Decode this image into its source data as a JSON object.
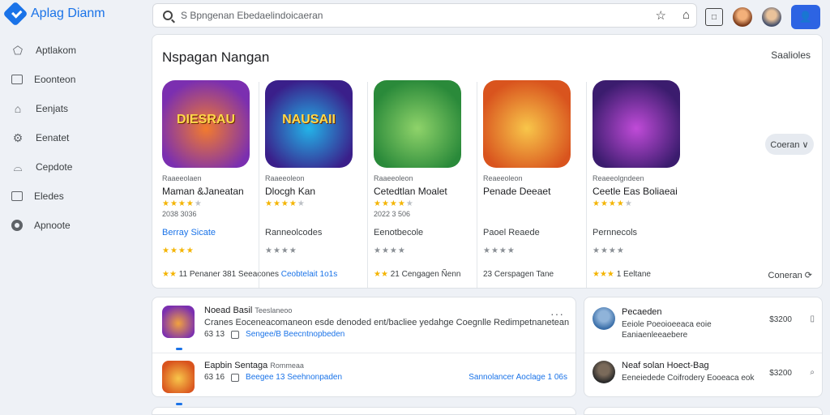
{
  "app": {
    "title": "Aplag Dianm"
  },
  "search": {
    "value": "S Bpngenan Ebedaelindoicaeran"
  },
  "header": {
    "search_actions": [
      "☆",
      "⌂"
    ],
    "box_icon": "□"
  },
  "sidebar": {
    "items": [
      {
        "label": "Aptlakom",
        "icon": "shape-icon"
      },
      {
        "label": "Eoonteon",
        "icon": "screen-icon"
      },
      {
        "label": "Eenjats",
        "icon": "home-icon"
      },
      {
        "label": "Eenatet",
        "icon": "gear-icon"
      },
      {
        "label": "Cepdote",
        "icon": "bag-icon"
      },
      {
        "label": "Eledes",
        "icon": "news-icon"
      },
      {
        "label": "Apnoote",
        "icon": "eye-icon"
      }
    ]
  },
  "section": {
    "title": "Nspagan Nangan",
    "see_all": "Saalioles",
    "next_label": "Coeran ∨",
    "more_link": "Coneran ⟳"
  },
  "apps": [
    {
      "icon_text": "DIESRAU",
      "category": "Raaeeolaen",
      "name": "Maman &Janeatan",
      "rating": 3.5,
      "meta": "2038 3036",
      "sub": "Berray Sicate",
      "sub_blue": true,
      "rating2": 3,
      "rating2_color": "gold",
      "foot_prefix": "★★",
      "foot": "11 Penaner 381 Seeacones",
      "foot_link": "Ceobtelait 1o1s",
      "colors": [
        "#7b2fb0",
        "#f27b2e"
      ]
    },
    {
      "icon_text": "NAUSAII",
      "category": "Raaeeoleon",
      "name": "Dlocgh Kan",
      "rating": 4,
      "meta": "",
      "sub": "Ranneolcodes",
      "sub_blue": false,
      "rating2": 4,
      "rating2_color": "grey",
      "foot_prefix": "",
      "foot": "",
      "foot_link": "",
      "colors": [
        "#3a1f8a",
        "#23b3e8"
      ]
    },
    {
      "icon_text": "",
      "category": "Raaeeoleon",
      "name": "Cetedtlan Moalet",
      "rating": 3.5,
      "meta": "2022 3 506",
      "sub": "Eenotbecole",
      "sub_blue": false,
      "rating2": 3,
      "rating2_color": "grey",
      "foot_prefix": "★★",
      "foot": "21 Cengagen Ñenn",
      "foot_link": "",
      "colors": [
        "#2a8a3a",
        "#8fd36a"
      ]
    },
    {
      "icon_text": "",
      "category": "Reaeeoleon",
      "name": "Penade Deeaet",
      "rating": 0,
      "meta": "",
      "sub": "Paoel Reaede",
      "sub_blue": false,
      "rating2": 4,
      "rating2_color": "grey",
      "foot_prefix": "",
      "foot": "23 Cerspagen Tane",
      "foot_link": "",
      "colors": [
        "#d9541e",
        "#f8c64a"
      ]
    },
    {
      "icon_text": "",
      "category": "Reaeeolgndeen",
      "name": "Ceetle Eas Boliaeai",
      "rating": 4,
      "meta": "",
      "sub": "Pernnecols",
      "sub_blue": false,
      "rating2": 3,
      "rating2_color": "grey",
      "foot_prefix": "★★★",
      "foot": "1 Eeltane",
      "foot_link": "",
      "colors": [
        "#3b1c6e",
        "#c04bd8"
      ]
    }
  ],
  "list": {
    "kebab": "···",
    "rows": [
      {
        "title": "Noead Basil",
        "tag": "Teeslaneoo",
        "desc": "Cranes Eoceneacomaneon esde denoded ent/bacliee yedahge Coegnlle Redimpetnanetean",
        "meta_prefix": "63 13",
        "link": "Sengee/B Beecntnopbeden",
        "right": "",
        "colors": [
          "#7b2fb0",
          "#f2a23e"
        ]
      },
      {
        "title": "Eapbin Sentaga",
        "tag": "Rommeaa",
        "desc": "",
        "meta_prefix": "63 16",
        "link": "Beegee 13 Seehnonpaden",
        "right": "Sannolancer Aoclage 1 06s",
        "colors": [
          "#d9541e",
          "#f8c64a"
        ]
      }
    ]
  },
  "side_list": {
    "rows": [
      {
        "title": "Pecaeden",
        "desc": "Eeiole Poeoioeeaca eoie Eaniaenleeaebere",
        "price": "$3200",
        "action": "▯",
        "colors": [
          "#3a6ea8",
          "#8fb3d9"
        ]
      },
      {
        "title": "Neaf solan Hoect-Bag",
        "desc": "Eeneiedede Coifrodery Eooeaca eok",
        "price": "$3200",
        "action": "⌕",
        "colors": [
          "#2a2a2a",
          "#7a6a5a"
        ]
      }
    ]
  }
}
